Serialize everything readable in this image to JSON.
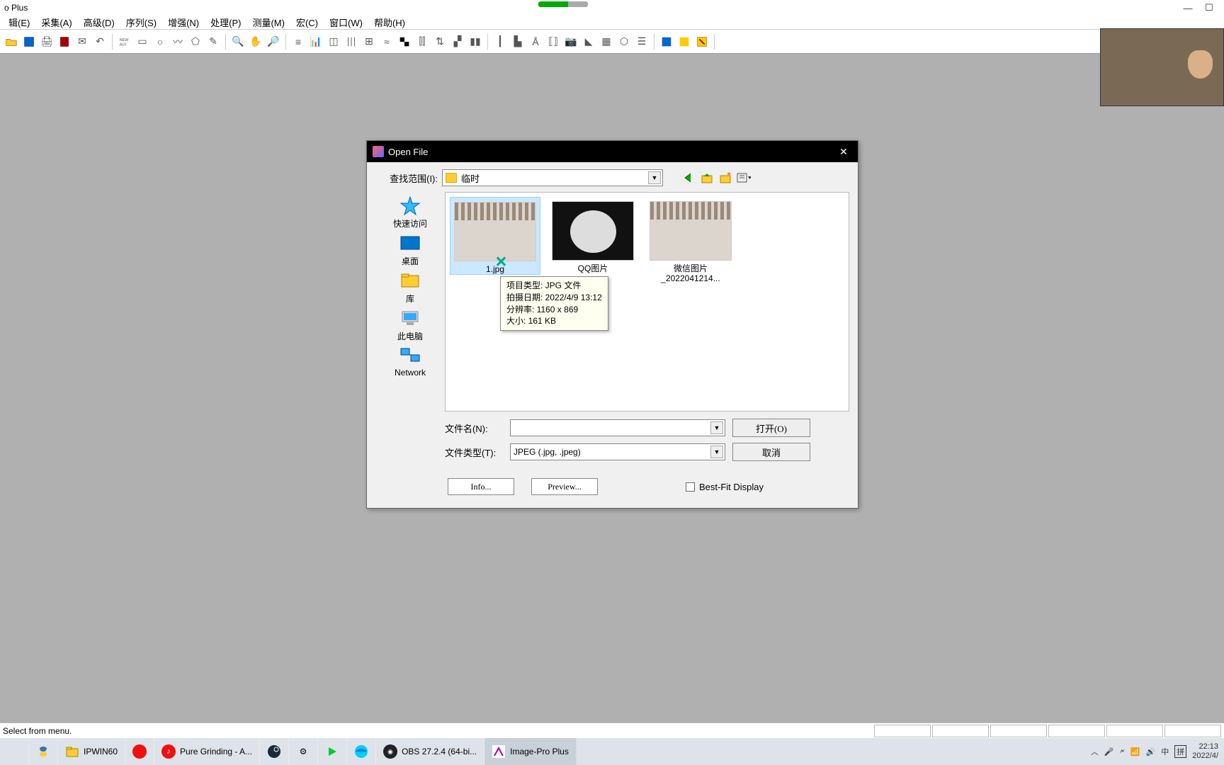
{
  "titlebar": {
    "title": "o Plus",
    "minimize": "—",
    "maximize": "☐",
    "close": "✕"
  },
  "menus": [
    "辑(E)",
    "采集(A)",
    "高级(D)",
    "序列(S)",
    "增强(N)",
    "处理(P)",
    "测量(M)",
    "宏(C)",
    "窗口(W)",
    "帮助(H)"
  ],
  "dialog": {
    "title": "Open File",
    "lookInLabel": "查找范围(I):",
    "lookInValue": "临时",
    "places": [
      {
        "name": "快速访问"
      },
      {
        "name": "桌面"
      },
      {
        "name": "库"
      },
      {
        "name": "此电脑"
      },
      {
        "name": "Network"
      }
    ],
    "files": [
      {
        "name": "1.jpg"
      },
      {
        "name": "QQ图片",
        "line2": "…"
      },
      {
        "name": "微信图片",
        "line2": "_2022041214..."
      }
    ],
    "tooltip": {
      "l1": "项目类型: JPG 文件",
      "l2": "拍摄日期: 2022/4/9 13:12",
      "l3": "分辨率: 1160 x 869",
      "l4": "大小: 161 KB"
    },
    "filenameLabel": "文件名(N):",
    "filenameValue": "",
    "filetypeLabel": "文件类型(T):",
    "filetypeValue": "JPEG (.jpg, .jpeg)",
    "openBtn": "打开(O)",
    "cancelBtn": "取消",
    "infoBtn": "Info...",
    "previewBtn": "Preview...",
    "bestFit": "Best-Fit Display"
  },
  "status": "Select from menu.",
  "taskbar": {
    "items": [
      {
        "label": "",
        "icon": "python"
      },
      {
        "label": "IPWIN60",
        "icon": "folder"
      },
      {
        "label": "",
        "icon": "red-swirl"
      },
      {
        "label": "Pure Grinding - A...",
        "icon": "red-circle"
      },
      {
        "label": "",
        "icon": "steam"
      },
      {
        "label": "",
        "icon": "gear"
      },
      {
        "label": "",
        "icon": "play"
      },
      {
        "label": "",
        "icon": "edge"
      },
      {
        "label": "OBS 27.2.4 (64-bi...",
        "icon": "obs"
      },
      {
        "label": "Image-Pro Plus",
        "icon": "ipp"
      }
    ],
    "ime": "中",
    "ime2": "拼",
    "time": "22:13",
    "date": "2022/4/"
  }
}
